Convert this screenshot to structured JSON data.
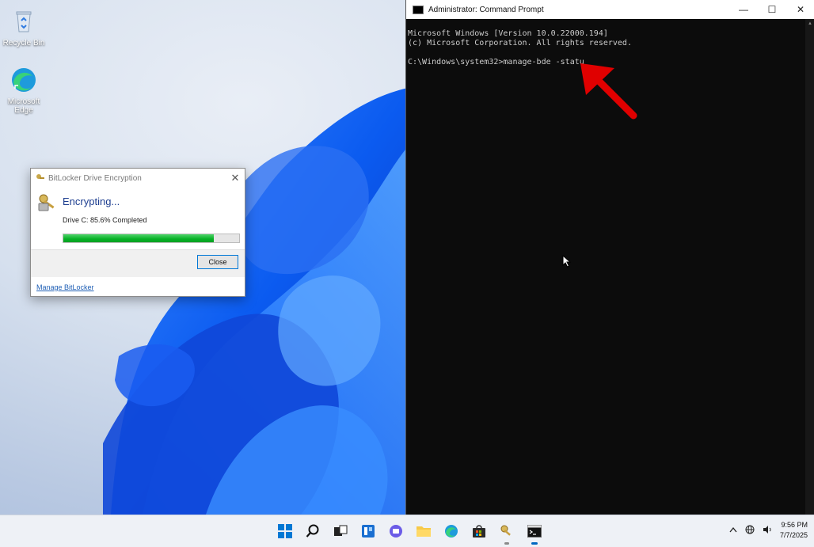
{
  "desktop": {
    "icons": [
      {
        "label": "Recycle Bin"
      },
      {
        "label": "Microsoft Edge"
      }
    ]
  },
  "bitlocker": {
    "title": "BitLocker Drive Encryption",
    "heading": "Encrypting...",
    "status": "Drive C: 85.6% Completed",
    "progress_percent": 85.6,
    "close_label": "Close",
    "manage_link": "Manage BitLocker"
  },
  "cmd": {
    "title": "Administrator: Command Prompt",
    "lines": [
      "Microsoft Windows [Version 10.0.22000.194]",
      "(c) Microsoft Corporation. All rights reserved.",
      "",
      "C:\\Windows\\system32>manage-bde -statu"
    ],
    "controls": {
      "minimize": "—",
      "maximize": "☐",
      "close": "✕"
    }
  },
  "taskbar": {
    "apps": [
      "start-icon",
      "search-icon",
      "task-view-icon",
      "widgets-icon",
      "chat-icon",
      "file-explorer-icon",
      "edge-icon",
      "store-icon",
      "bitlocker-icon",
      "command-prompt-icon"
    ],
    "clock_time": "9:56 PM",
    "clock_date": "7/7/2025"
  },
  "colors": {
    "accent": "#0067c0",
    "progress": "#06b025",
    "annotation_arrow": "#e00000"
  }
}
